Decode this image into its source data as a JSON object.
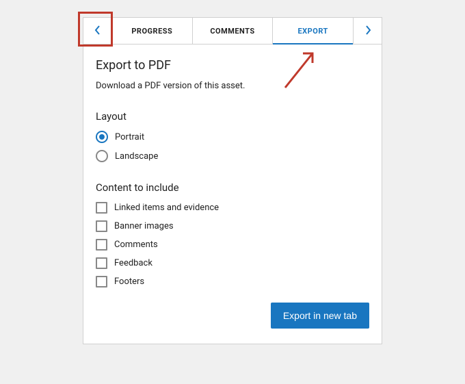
{
  "tabs": {
    "progress": "PROGRESS",
    "comments": "COMMENTS",
    "export": "EXPORT"
  },
  "heading": "Export to PDF",
  "description": "Download a PDF version of this asset.",
  "layout": {
    "label": "Layout",
    "portrait": "Portrait",
    "landscape": "Landscape"
  },
  "content": {
    "label": "Content to include",
    "linked": "Linked items and evidence",
    "banner": "Banner images",
    "comments": "Comments",
    "feedback": "Feedback",
    "footers": "Footers"
  },
  "button": "Export in new tab",
  "colors": {
    "accent": "#1976c0",
    "annotation": "#c0392b"
  }
}
